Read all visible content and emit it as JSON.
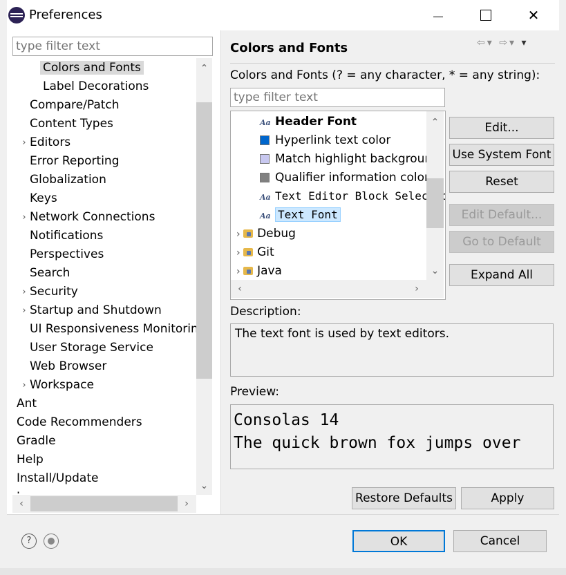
{
  "window": {
    "title": "Preferences",
    "minimize": "—",
    "maximize": "☐",
    "close": "✕"
  },
  "left": {
    "filter_placeholder": "type filter text",
    "tree": [
      {
        "label": "Colors and Fonts",
        "indent": 2,
        "arrow": false,
        "selected": true
      },
      {
        "label": "Label Decorations",
        "indent": 2,
        "arrow": false
      },
      {
        "label": "Compare/Patch",
        "indent": 1,
        "arrow": false
      },
      {
        "label": "Content Types",
        "indent": 1,
        "arrow": false
      },
      {
        "label": "Editors",
        "indent": 1,
        "arrow": true
      },
      {
        "label": "Error Reporting",
        "indent": 1,
        "arrow": false
      },
      {
        "label": "Globalization",
        "indent": 1,
        "arrow": false
      },
      {
        "label": "Keys",
        "indent": 1,
        "arrow": false
      },
      {
        "label": "Network Connections",
        "indent": 1,
        "arrow": true
      },
      {
        "label": "Notifications",
        "indent": 1,
        "arrow": false
      },
      {
        "label": "Perspectives",
        "indent": 1,
        "arrow": false
      },
      {
        "label": "Search",
        "indent": 1,
        "arrow": false
      },
      {
        "label": "Security",
        "indent": 1,
        "arrow": true
      },
      {
        "label": "Startup and Shutdown",
        "indent": 1,
        "arrow": true
      },
      {
        "label": "UI Responsiveness Monitoring",
        "indent": 1,
        "arrow": false
      },
      {
        "label": "User Storage Service",
        "indent": 1,
        "arrow": false
      },
      {
        "label": "Web Browser",
        "indent": 1,
        "arrow": false
      },
      {
        "label": "Workspace",
        "indent": 1,
        "arrow": true
      },
      {
        "label": "Ant",
        "indent": 0,
        "arrow": true
      },
      {
        "label": "Code Recommenders",
        "indent": 0,
        "arrow": true
      },
      {
        "label": "Gradle",
        "indent": 0,
        "arrow": false
      },
      {
        "label": "Help",
        "indent": 0,
        "arrow": true
      },
      {
        "label": "Install/Update",
        "indent": 0,
        "arrow": true
      },
      {
        "label": "Java",
        "indent": 0,
        "arrow": true
      }
    ]
  },
  "right": {
    "title": "Colors and Fonts",
    "filter_label": "Colors and Fonts (? = any character, * = any string):",
    "filter_placeholder": "type filter text",
    "items": [
      {
        "label": "Header Font",
        "kind": "font",
        "bold": true
      },
      {
        "label": "Hyperlink text color",
        "kind": "color",
        "color": "#0066cc"
      },
      {
        "label": "Match highlight background",
        "kind": "color",
        "color": "#c8c8f0"
      },
      {
        "label": "Qualifier information color",
        "kind": "color",
        "color": "#808080"
      },
      {
        "label": "Text Editor Block Selection Font",
        "kind": "font",
        "mono": true
      },
      {
        "label": "Text Font",
        "kind": "font",
        "mono": true,
        "selected": true
      },
      {
        "label": "Debug",
        "kind": "folder"
      },
      {
        "label": "Git",
        "kind": "folder"
      },
      {
        "label": "Java",
        "kind": "folder"
      }
    ],
    "buttons": {
      "edit": "Edit...",
      "use_system_font": "Use System Font",
      "reset": "Reset",
      "edit_default": "Edit Default...",
      "go_to_default": "Go to Default",
      "expand_all": "Expand All"
    },
    "description_label": "Description:",
    "description_text": "The text font is used by text editors.",
    "preview_label": "Preview:",
    "preview_lines": [
      "Consolas 14",
      "The quick brown fox jumps over"
    ],
    "restore_defaults": "Restore Defaults",
    "apply": "Apply"
  },
  "footer": {
    "ok": "OK",
    "cancel": "Cancel"
  }
}
